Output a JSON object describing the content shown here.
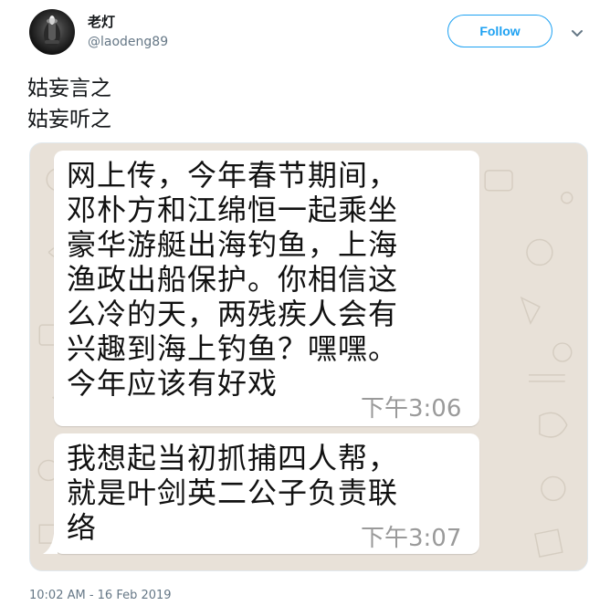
{
  "user": {
    "display_name": "老灯",
    "handle": "@laodeng89"
  },
  "header": {
    "follow_label": "Follow"
  },
  "tweet": {
    "lines": [
      "姑妄言之",
      "姑妄听之"
    ],
    "timestamp": "10:02 AM - 16 Feb 2019"
  },
  "media": {
    "messages": [
      {
        "lines": [
          "网上传，今年春节期间，",
          "邓朴方和江绵恒一起乘坐",
          "豪华游艇出海钓鱼，上海",
          "渔政出船保护。你相信这",
          "么冷的天，两残疾人会有",
          "兴趣到海上钓鱼？嘿嘿。",
          "今年应该有好戏"
        ],
        "time": "下午3:06"
      },
      {
        "lines": [
          "我想起当初抓捕四人帮，",
          "就是叶剑英二公子负责联",
          "络"
        ],
        "time": "下午3:07"
      }
    ]
  },
  "colors": {
    "accent": "#1da1f2",
    "chat_background": "#e8e1d8",
    "bubble": "#ffffff",
    "secondary_text": "#657786"
  },
  "icons": {
    "avatar": "avatar-image",
    "more": "chevron-down-icon"
  }
}
